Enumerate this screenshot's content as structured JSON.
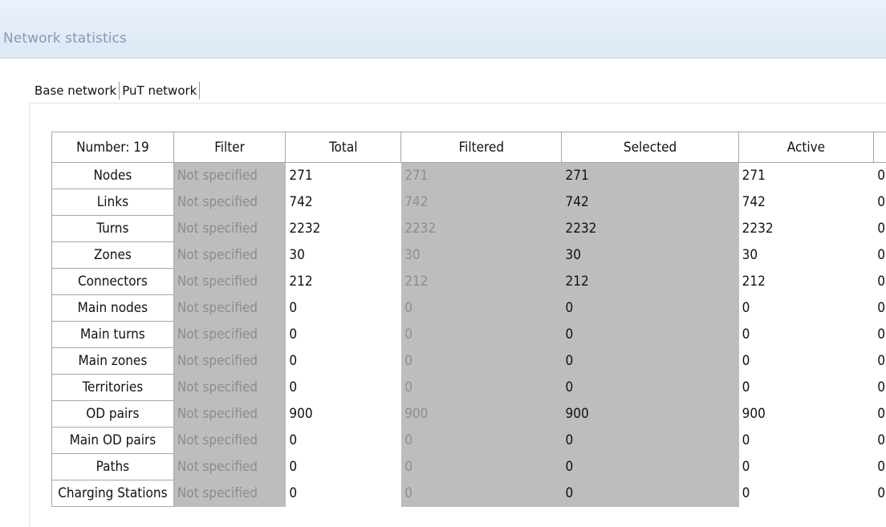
{
  "window": {
    "title": "Network statistics"
  },
  "tabs": [
    {
      "label": "Base network"
    },
    {
      "label": "PuT network"
    }
  ],
  "grid": {
    "headers": {
      "number": "Number: 19",
      "filter": "Filter",
      "total": "Total",
      "filtered": "Filtered",
      "selected": "Selected",
      "active": "Active"
    },
    "rows": [
      {
        "name": "Nodes",
        "filter": "Not specified",
        "total": "271",
        "filtered": "271",
        "selected": "271",
        "active": "271",
        "extra": "0"
      },
      {
        "name": "Links",
        "filter": "Not specified",
        "total": "742",
        "filtered": "742",
        "selected": "742",
        "active": "742",
        "extra": "0"
      },
      {
        "name": "Turns",
        "filter": "Not specified",
        "total": "2232",
        "filtered": "2232",
        "selected": "2232",
        "active": "2232",
        "extra": "0"
      },
      {
        "name": "Zones",
        "filter": "Not specified",
        "total": "30",
        "filtered": "30",
        "selected": "30",
        "active": "30",
        "extra": "0"
      },
      {
        "name": "Connectors",
        "filter": "Not specified",
        "total": "212",
        "filtered": "212",
        "selected": "212",
        "active": "212",
        "extra": "0"
      },
      {
        "name": "Main nodes",
        "filter": "Not specified",
        "total": "0",
        "filtered": "0",
        "selected": "0",
        "active": "0",
        "extra": "0"
      },
      {
        "name": "Main turns",
        "filter": "Not specified",
        "total": "0",
        "filtered": "0",
        "selected": "0",
        "active": "0",
        "extra": "0"
      },
      {
        "name": "Main zones",
        "filter": "Not specified",
        "total": "0",
        "filtered": "0",
        "selected": "0",
        "active": "0",
        "extra": "0"
      },
      {
        "name": "Territories",
        "filter": "Not specified",
        "total": "0",
        "filtered": "0",
        "selected": "0",
        "active": "0",
        "extra": "0"
      },
      {
        "name": "OD pairs",
        "filter": "Not specified",
        "total": "900",
        "filtered": "900",
        "selected": "900",
        "active": "900",
        "extra": "0"
      },
      {
        "name": "Main OD pairs",
        "filter": "Not specified",
        "total": "0",
        "filtered": "0",
        "selected": "0",
        "active": "0",
        "extra": "0"
      },
      {
        "name": "Paths",
        "filter": "Not specified",
        "total": "0",
        "filtered": "0",
        "selected": "0",
        "active": "0",
        "extra": "0"
      },
      {
        "name": "Charging Stations",
        "filter": "Not specified",
        "total": "0",
        "filtered": "0",
        "selected": "0",
        "active": "0",
        "extra": "0"
      }
    ]
  },
  "colors": {
    "titlebar_bg": "#dde8f5",
    "title_text": "#8a98ad",
    "shaded_cell": "#bdbdbd",
    "dim_text": "#8c8c8c"
  }
}
